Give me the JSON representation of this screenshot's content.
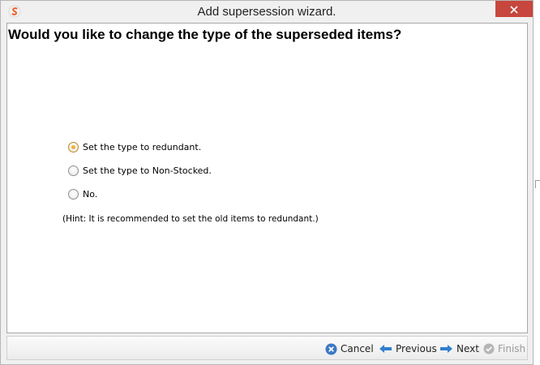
{
  "window": {
    "title": "Add supersession wizard."
  },
  "content": {
    "question": "Would you like to change the type of the superseded items?",
    "options": [
      {
        "label": "Set the type to redundant.",
        "selected": true
      },
      {
        "label": "Set the type to Non-Stocked.",
        "selected": false
      },
      {
        "label": "No.",
        "selected": false
      }
    ],
    "hint": "(Hint: It is recommended to set the old items to redundant.)"
  },
  "footer": {
    "cancel_label": "Cancel",
    "previous_label": "Previous",
    "next_label": "Next",
    "finish_label": "Finish"
  },
  "colors": {
    "close_button": "#c7463d",
    "radio_selected": "#f0b23a",
    "nav_arrow": "#2f7fd0",
    "cancel_icon": "#3b78c5",
    "finish_disabled": "#b5b5b5"
  },
  "icons": {
    "app": "app-logo-icon",
    "close": "close-icon",
    "cancel": "cancel-icon",
    "previous": "arrow-left-icon",
    "next": "arrow-right-icon",
    "finish": "checkmark-icon"
  }
}
